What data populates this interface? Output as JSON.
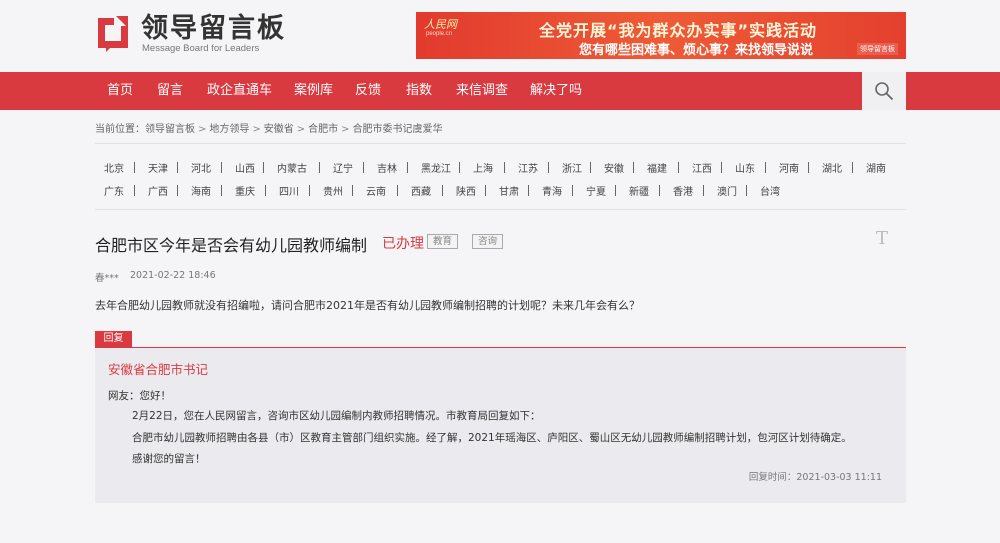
{
  "header": {
    "logo_title": "领导留言板",
    "logo_subtitle": "Message Board for Leaders"
  },
  "banner": {
    "brand": "人民网",
    "brand_sub": "people.cn",
    "line1": "全党开展“我为群众办实事”实践活动",
    "line2": "您有哪些困难事、烦心事？来找领导说说",
    "badge": "领导留言板"
  },
  "nav": {
    "items": [
      "首页",
      "留言",
      "政企直通车",
      "案例库",
      "反馈",
      "指数",
      "来信调查",
      "解决了吗"
    ],
    "search_icon": "search-icon"
  },
  "breadcrumb": {
    "prefix": "当前位置：",
    "items": [
      "领导留言板",
      "地方领导",
      "安徽省",
      "合肥市",
      "合肥市委书记虞爱华"
    ],
    "separator": ">"
  },
  "provinces": {
    "row1": [
      "北京",
      "天津",
      "河北",
      "山西",
      "内蒙古",
      "辽宁",
      "吉林",
      "黑龙江",
      "上海",
      "江苏",
      "浙江",
      "安徽",
      "福建",
      "江西",
      "山东",
      "河南",
      "湖北",
      "湖南"
    ],
    "row2": [
      "广东",
      "广西",
      "海南",
      "重庆",
      "四川",
      "贵州",
      "云南",
      "西藏",
      "陕西",
      "甘肃",
      "青海",
      "宁夏",
      "新疆",
      "香港",
      "澳门",
      "台湾"
    ]
  },
  "question": {
    "title": "合肥市区今年是否会有幼儿园教师编制",
    "status": "已办理",
    "tags": [
      "教育",
      "咨询"
    ],
    "corner_mark": "T",
    "author": "春***",
    "date": "2021-02-22 18:46",
    "body": "去年合肥幼儿园教师就没有招编啦，请问合肥市2021年是否有幼儿园教师编制招聘的计划呢？未来几年会有么？"
  },
  "reply": {
    "label": "回复",
    "author": "安徽省合肥市书记",
    "greeting": "网友：您好！",
    "paragraphs": [
      "2月22日，您在人民网留言，咨询市区幼儿园编制内教师招聘情况。市教育局回复如下：",
      "合肥市幼儿园教师招聘由各县（市）区教育主管部门组织实施。经了解，2021年瑶海区、庐阳区、蜀山区无幼儿园教师编制招聘计划，包河区计划待确定。",
      "感谢您的留言！"
    ],
    "time": "回复时间：2021-03-03 11:11"
  },
  "colors": {
    "accent": "#d93a40",
    "page_bg": "#f5f5f7",
    "reply_bg": "#ebebef"
  }
}
